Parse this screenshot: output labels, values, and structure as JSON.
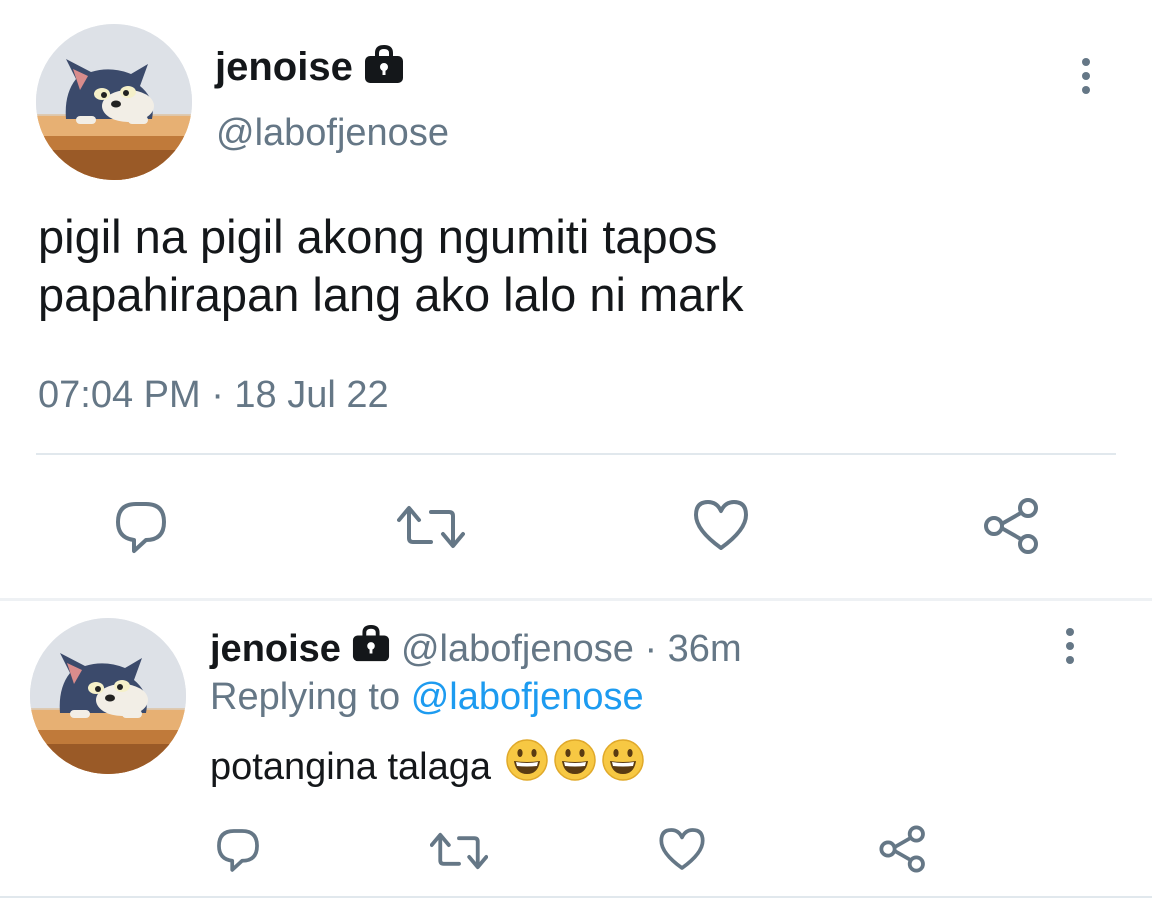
{
  "main_tweet": {
    "display_name": "jenoise",
    "handle": "@labofjenose",
    "text_line1": "pigil na pigil akong ngumiti tapos",
    "text_line2": "papahirapan lang ako lalo ni mark",
    "timestamp": "07:04 PM · 18 Jul 22"
  },
  "reply_tweet": {
    "display_name": "jenoise",
    "handle_time": "@labofjenose · 36m",
    "replying_prefix": "Replying to",
    "replying_handle": "@labofjenose",
    "text": "potangina talaga"
  },
  "colors": {
    "text": "#14171a",
    "muted": "#657786",
    "link": "#1d9bf0",
    "divider": "#e1e8ed",
    "emoji": "#f7c843"
  },
  "icons": [
    "lock-icon",
    "more-options-icon",
    "reply-icon",
    "retweet-icon",
    "like-icon",
    "share-icon",
    "grinning-face-emoji"
  ]
}
